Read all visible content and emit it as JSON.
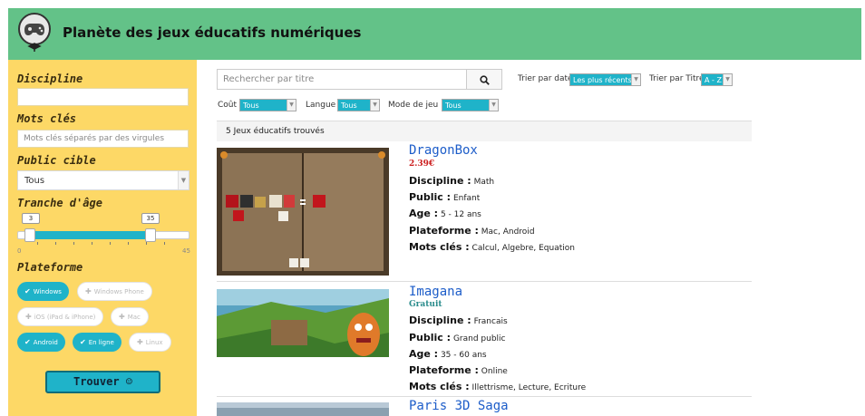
{
  "header": {
    "title": "Planète des jeux éducatifs numériques",
    "logo_icon": "gamepad-icon"
  },
  "sidebar": {
    "discipline_label": "Discipline",
    "discipline_value": "",
    "keywords_label": "Mots clés",
    "keywords_placeholder": "Mots clés séparés par des virgules",
    "audience_label": "Public cible",
    "audience_value": "Tous",
    "age_label": "Tranche d'âge",
    "age_low": "3",
    "age_high": "35",
    "age_min": "0",
    "age_max": "45",
    "platform_label": "Plateforme",
    "platforms": [
      {
        "label": "Windows",
        "selected": true
      },
      {
        "label": "Windows Phone",
        "selected": false
      },
      {
        "label": "iOS (iPad & iPhone)",
        "selected": false
      },
      {
        "label": "Mac",
        "selected": false
      },
      {
        "label": "Android",
        "selected": true
      },
      {
        "label": "En ligne",
        "selected": true
      },
      {
        "label": "Linux",
        "selected": false
      }
    ],
    "find_button": "Trouver ☺"
  },
  "toolbar": {
    "search_placeholder": "Rechercher par titre",
    "sort_date_label": "Trier par date",
    "sort_date_value": "Les plus récents",
    "sort_title_label": "Trier par Titre",
    "sort_title_value": "A - Z",
    "cost_label": "Coût",
    "cost_value": "Tous",
    "language_label": "Langue",
    "language_value": "Tous",
    "mode_label": "Mode de jeu",
    "mode_value": "Tous"
  },
  "results": {
    "count_text": "5 Jeux éducatifs trouvés",
    "labels": {
      "discipline": "Discipline :",
      "public": "Public :",
      "age": "Age :",
      "platform": "Plateforme :",
      "keywords": "Mots clés :"
    },
    "games": [
      {
        "title": "DragonBox",
        "price": "2.39€",
        "discipline": "Math",
        "public": "Enfant",
        "age": "5 - 12 ans",
        "platform": "Mac, Android",
        "keywords": "Calcul, Algebre, Equation"
      },
      {
        "title": "Imagana",
        "price": "Gratuit",
        "discipline": "Francais",
        "public": "Grand public",
        "age": "35 - 60 ans",
        "platform": "Online",
        "keywords": "Illettrisme, Lecture, Ecriture"
      },
      {
        "title": "Paris 3D Saga"
      }
    ]
  },
  "colors": {
    "header_bg": "#63c288",
    "sidebar_bg": "#fdd866",
    "accent": "#1fb3c9",
    "price_paid": "#cc1f1f",
    "price_free": "#2a8c8c",
    "title_blue": "#1d5dc9"
  }
}
